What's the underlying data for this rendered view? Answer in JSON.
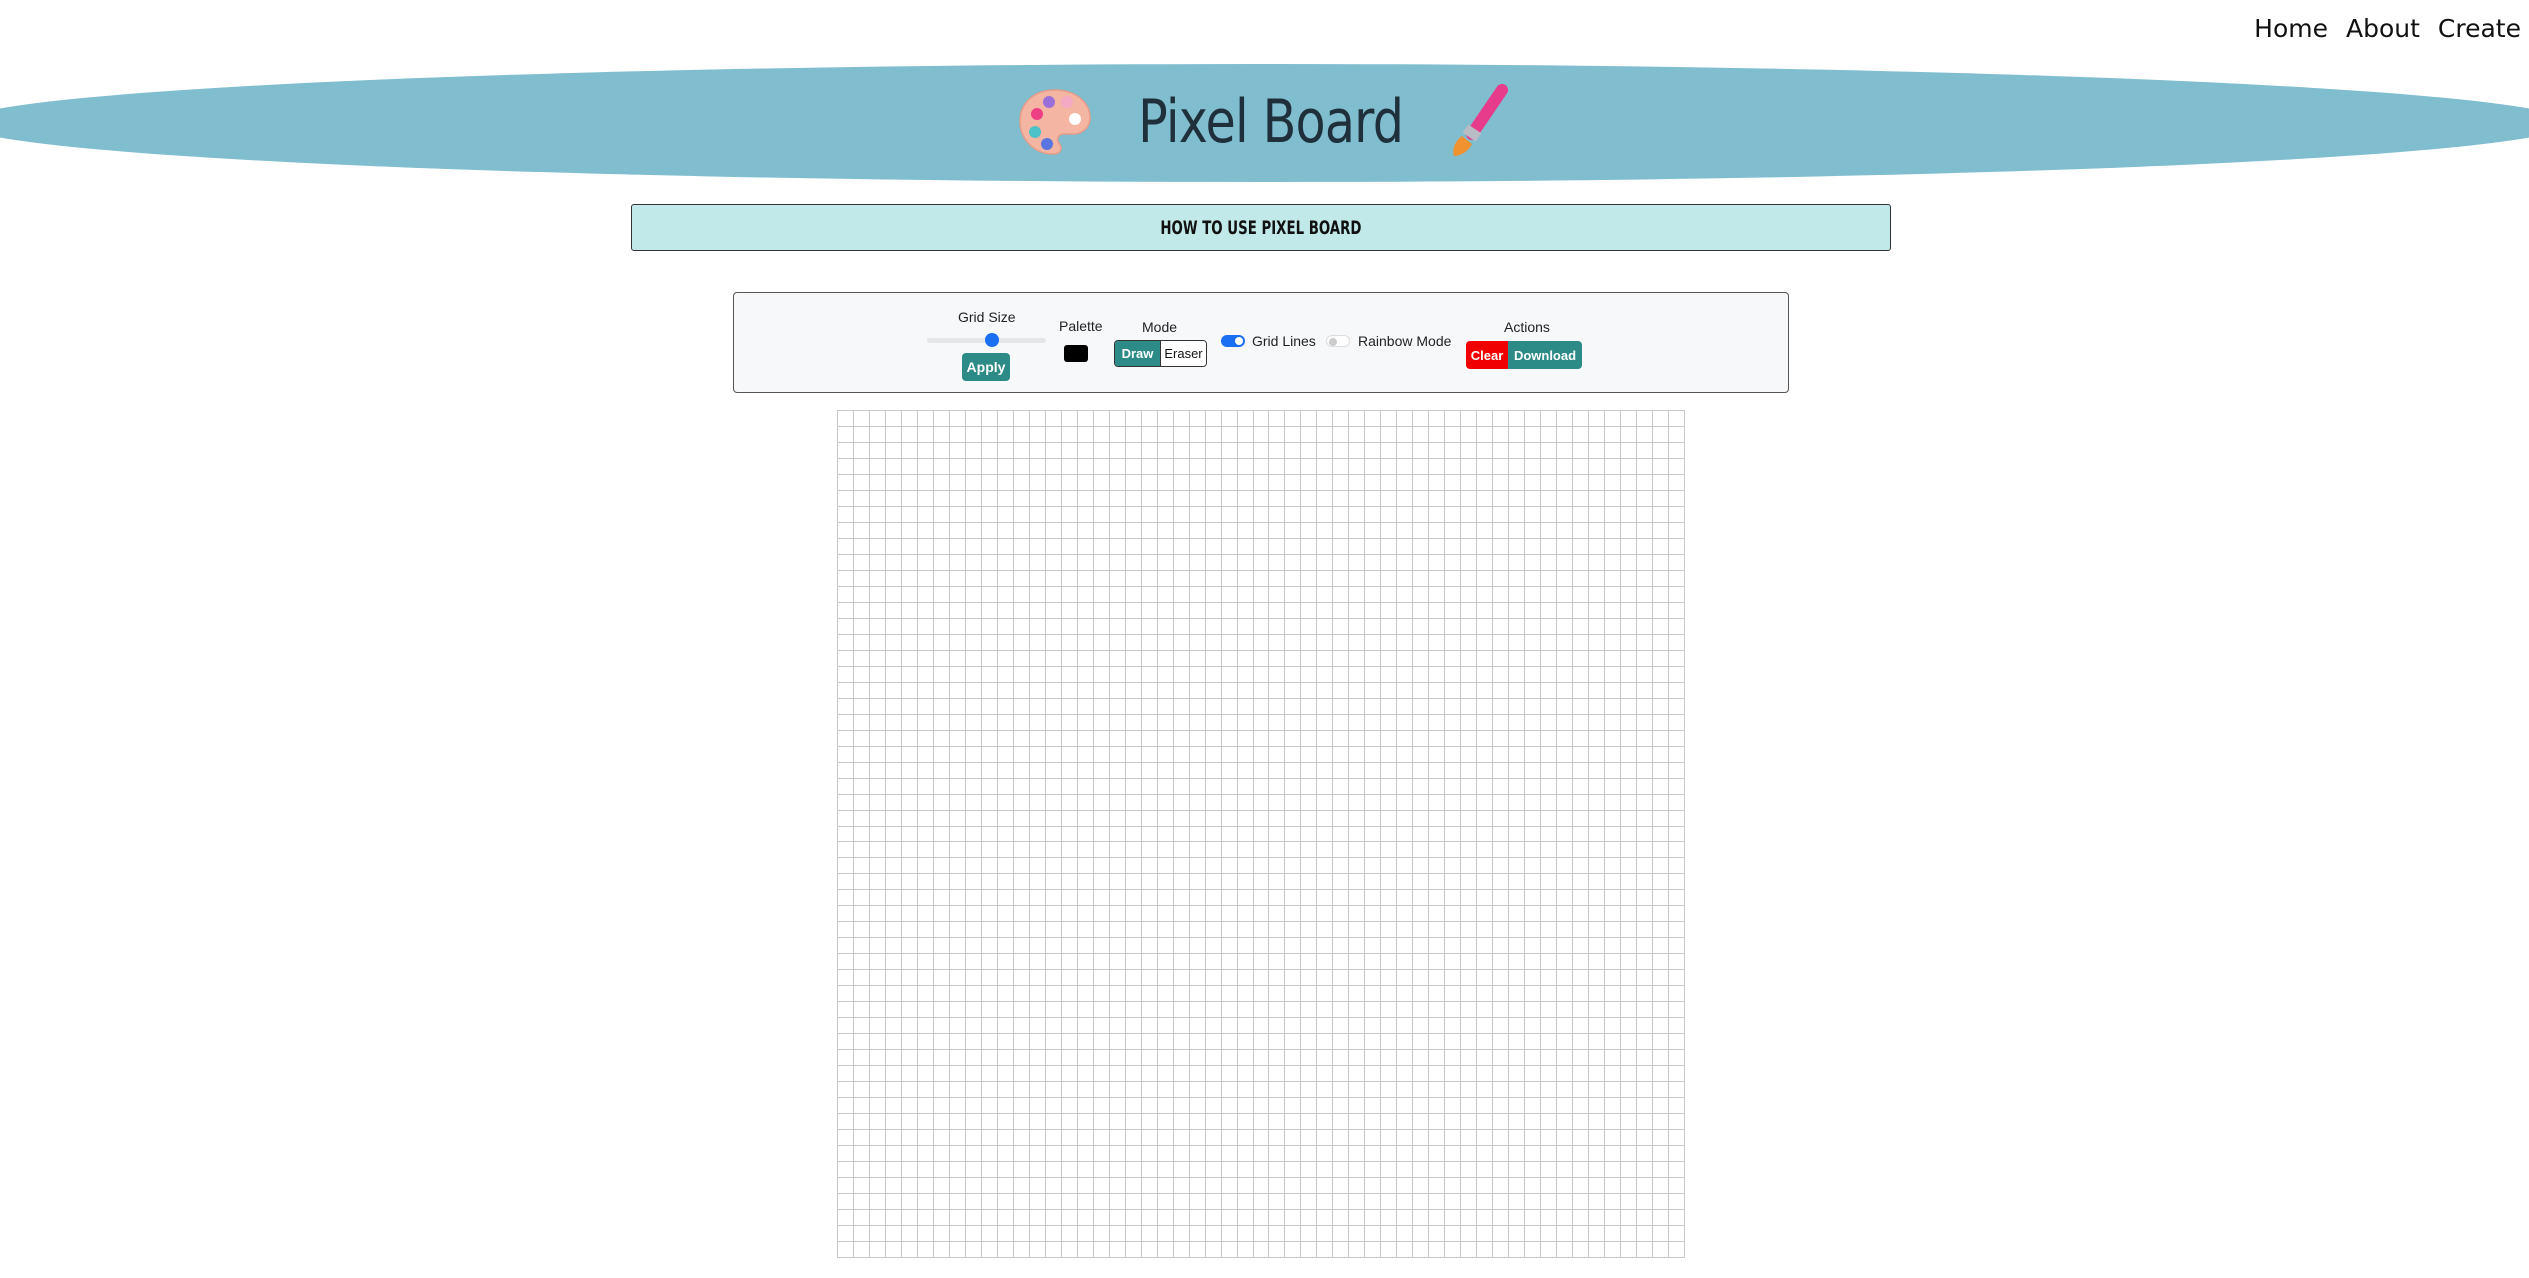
{
  "nav": {
    "links": [
      "Home",
      "About",
      "Create"
    ]
  },
  "header": {
    "title": "Pixel Board",
    "left_icon": "palette-icon",
    "right_icon": "paintbrush-icon",
    "banner_color": "#7fbdcf"
  },
  "howto": {
    "label": "HOW TO USE PIXEL BOARD",
    "bg_color": "#c2e9e9"
  },
  "toolbar": {
    "grid_size_label": "Grid Size",
    "grid_size_value_fraction": 0.55,
    "apply_label": "Apply",
    "palette_label": "Palette",
    "current_color": "#000000",
    "mode_label": "Mode",
    "draw_label": "Draw",
    "eraser_label": "Eraser",
    "active_mode": "Draw",
    "grid_lines_label": "Grid Lines",
    "grid_lines_on": true,
    "rainbow_label": "Rainbow Mode",
    "rainbow_on": false,
    "actions_label": "Actions",
    "clear_label": "Clear",
    "download_label": "Download",
    "accent_color": "#2c8a87",
    "danger_color": "#f00000"
  },
  "board": {
    "columns": 53,
    "rows": 53,
    "cell_color": "#ffffff",
    "grid_line_color": "#c8c8c8"
  }
}
